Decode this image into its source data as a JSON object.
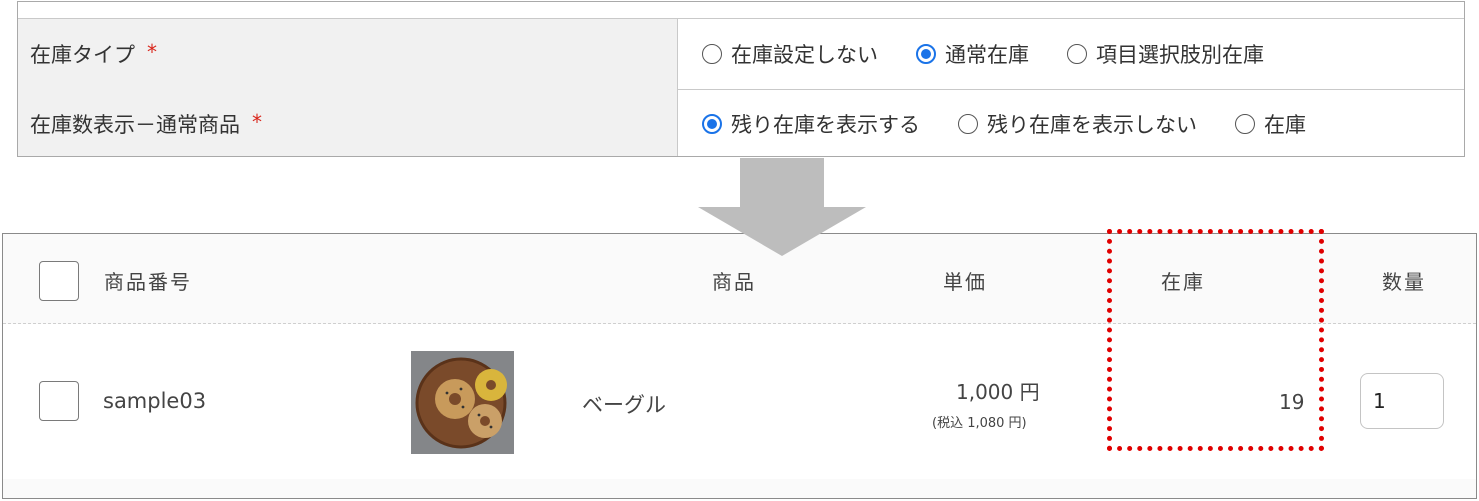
{
  "settings": {
    "stock_type": {
      "label": "在庫タイプ",
      "required_mark": "*",
      "options": [
        {
          "label": "在庫設定しない",
          "checked": false
        },
        {
          "label": "通常在庫",
          "checked": true
        },
        {
          "label": "項目選択肢別在庫",
          "checked": false
        }
      ]
    },
    "stock_display": {
      "label": "在庫数表示－通常商品",
      "required_mark": "*",
      "options": [
        {
          "label": "残り在庫を表示する",
          "checked": true
        },
        {
          "label": "残り在庫を表示しない",
          "checked": false
        },
        {
          "label": "在庫",
          "checked": false
        }
      ]
    }
  },
  "table": {
    "headers": {
      "number": "商品番号",
      "product": "商品",
      "price": "単価",
      "stock": "在庫",
      "quantity": "数量"
    },
    "rows": [
      {
        "number": "sample03",
        "name": "ベーグル",
        "price": "1,000 円",
        "price_tax": "(税込 1,080 円)",
        "stock": "19",
        "quantity": "1"
      }
    ]
  },
  "colors": {
    "radio_checked": "#1a73e8",
    "required": "#d9261c",
    "highlight": "#e00000",
    "arrow": "#bdbdbd"
  }
}
